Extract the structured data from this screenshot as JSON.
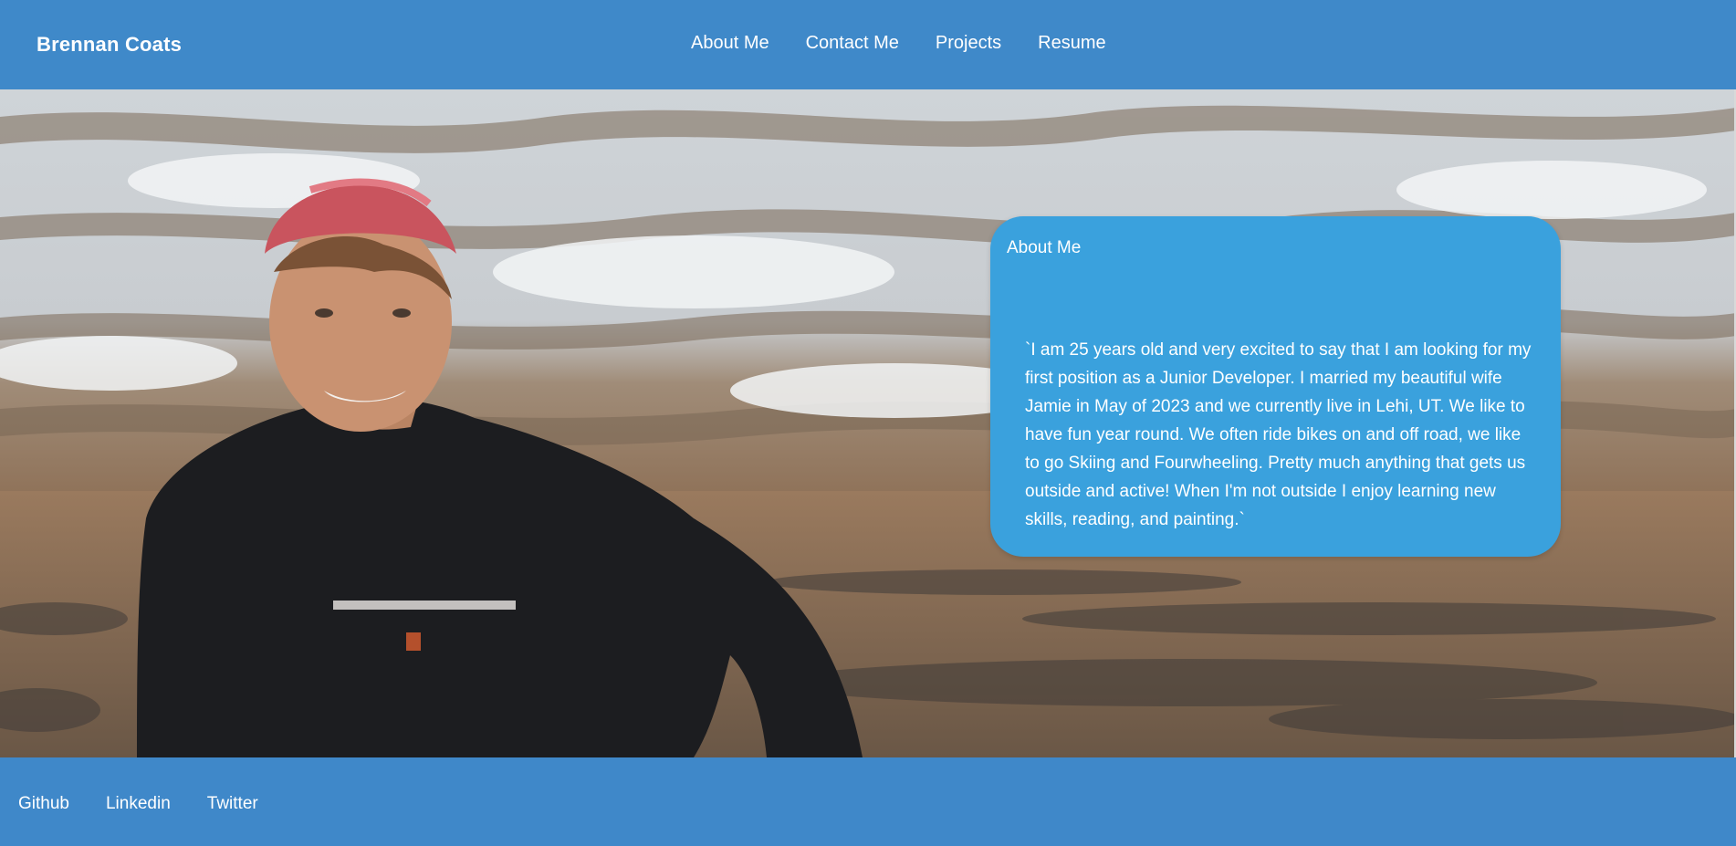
{
  "header": {
    "brand": "Brennan Coats",
    "nav": [
      "About Me",
      "Contact Me",
      "Projects",
      "Resume"
    ]
  },
  "about": {
    "title": "About Me",
    "text": "`I am 25 years old and very excited to say that I am looking for my first position as a Junior Developer. I married my beautiful wife Jamie in May of 2023 and we currently live in Lehi, UT. We like to have fun year round. We often ride bikes on and off road, we like to go Skiing and Fourwheeling. Pretty much anything that gets us outside and active! When I'm not outside I enjoy learning new skills, reading, and painting.`"
  },
  "footer": {
    "links": [
      "Github",
      "Linkedin",
      "Twitter"
    ]
  },
  "colors": {
    "header_bg": "#3f89c9",
    "card_bg": "#3aa1dd",
    "text": "#ffffff"
  }
}
